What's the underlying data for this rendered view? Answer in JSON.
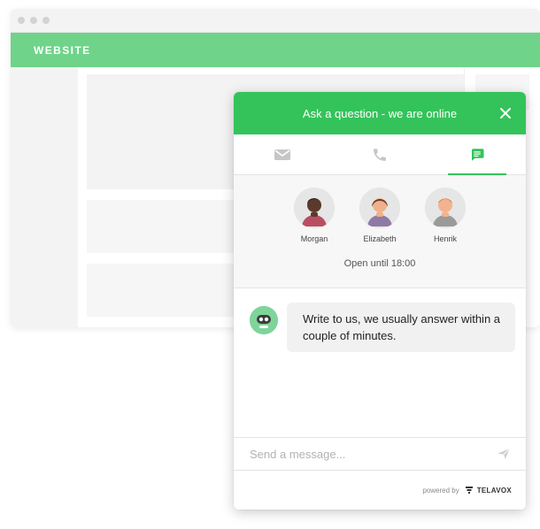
{
  "site": {
    "header_label": "WEBSITE"
  },
  "chat": {
    "header_title": "Ask a question - we are online",
    "tabs": [
      {
        "name": "email",
        "icon": "mail-icon",
        "active": false
      },
      {
        "name": "phone",
        "icon": "phone-icon",
        "active": false
      },
      {
        "name": "chat",
        "icon": "chat-icon",
        "active": true
      }
    ],
    "agents": [
      {
        "name": "Morgan"
      },
      {
        "name": "Elizabeth"
      },
      {
        "name": "Henrik"
      }
    ],
    "open_hours": "Open until 18:00",
    "message": "Write to us, we usually answer within a couple of minutes.",
    "composer_placeholder": "Send a message...",
    "footer": {
      "powered_by": "powered by",
      "brand": "TELAVOX"
    }
  },
  "colors": {
    "accent_green": "#33c35a",
    "site_header_green": "#6fd389"
  }
}
